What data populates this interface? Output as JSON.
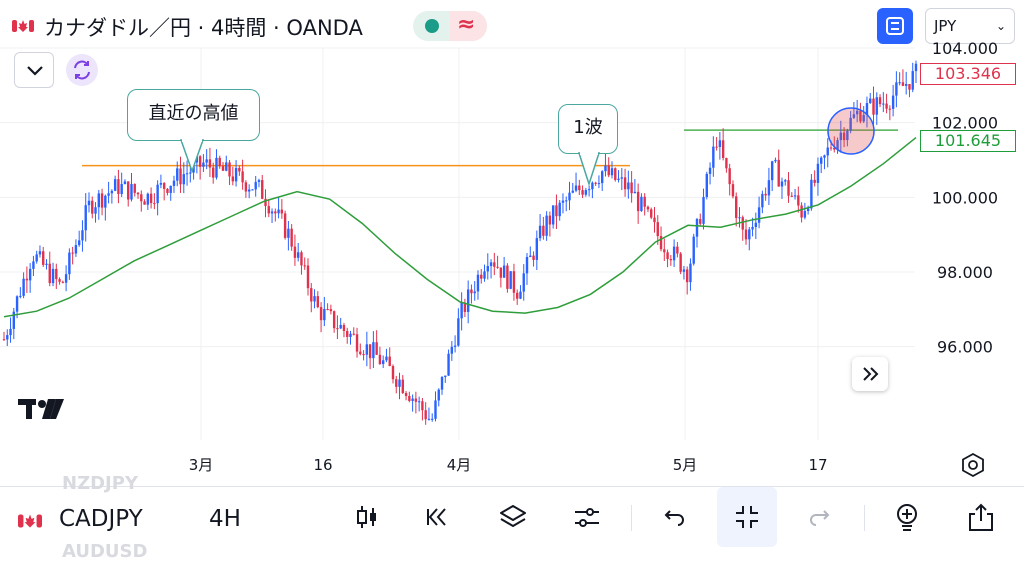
{
  "header": {
    "title": "カナダドル／円 · 4時間 · OANDA",
    "currency": "JPY"
  },
  "chart_data": {
    "type": "candlestick",
    "y_ticks": [
      "104.000",
      "102.000",
      "100.000",
      "98.000",
      "96.000"
    ],
    "x_ticks": [
      "3月",
      "16",
      "4月",
      "5月",
      "17"
    ],
    "ylim": [
      93.5,
      104.0
    ],
    "last_price": "103.346",
    "ma_price": "101.645",
    "horizontal_lines": [
      {
        "price": 100.85,
        "color": "#f7931a"
      },
      {
        "price": 101.8,
        "color": "#4caf50"
      }
    ],
    "annotations": [
      "直近の高値",
      "1波"
    ],
    "ma_values": [
      96.8,
      96.95,
      97.3,
      97.8,
      98.3,
      98.7,
      99.1,
      99.5,
      99.9,
      100.15,
      99.95,
      99.3,
      98.5,
      97.8,
      97.2,
      96.95,
      96.9,
      97.05,
      97.4,
      98.0,
      98.8,
      99.25,
      99.2,
      99.4,
      99.55,
      99.8,
      100.3,
      100.9,
      101.6
    ],
    "close_values": [
      96.2,
      98.5,
      97.6,
      99.8,
      100.3,
      100.0,
      100.5,
      100.9,
      100.6,
      100.2,
      99.0,
      97.0,
      96.4,
      95.8,
      95.0,
      94.0,
      96.8,
      98.5,
      97.5,
      99.3,
      100.1,
      100.7,
      100.2,
      98.9,
      98.0,
      101.6,
      98.8,
      100.8,
      99.6,
      101.4,
      102.3,
      102.6,
      103.3
    ],
    "colors": {
      "up": "#2962ff",
      "down": "#e0324d",
      "ma": "#2e9e3a"
    }
  },
  "labels": {
    "last_price": "103.346",
    "ma_price": "101.645",
    "callout_high": "直近の高値",
    "callout_wave": "1波",
    "tv_logo": "TV"
  },
  "toolbar": {
    "symbol": "CADJPY",
    "interval": "4H",
    "ghost_prev": "NZDJPY",
    "ghost_next": "AUDUSD"
  }
}
